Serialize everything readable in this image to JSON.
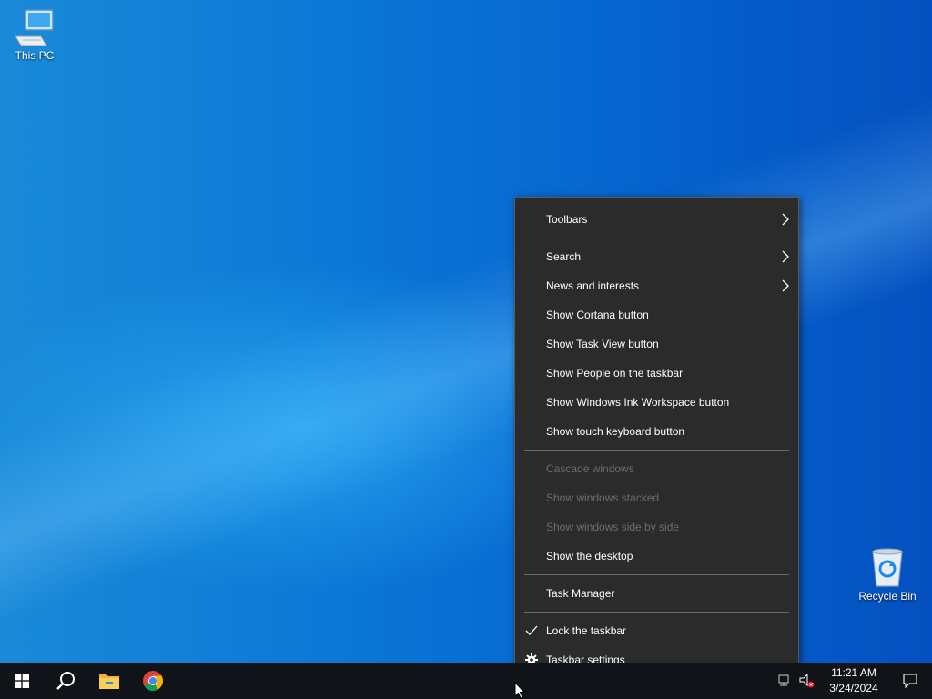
{
  "desktop": {
    "icons": [
      {
        "label": "This PC",
        "icon": "computer-icon"
      },
      {
        "label": "Recycle Bin",
        "icon": "recycle-bin-icon"
      }
    ]
  },
  "context_menu": {
    "items": {
      "toolbars": "Toolbars",
      "search": "Search",
      "news": "News and interests",
      "cortana": "Show Cortana button",
      "task_view": "Show Task View button",
      "people": "Show People on the taskbar",
      "ink": "Show Windows Ink Workspace button",
      "touch_keyboard": "Show touch keyboard button",
      "cascade": "Cascade windows",
      "stacked": "Show windows stacked",
      "side_by_side": "Show windows side by side",
      "show_desktop": "Show the desktop",
      "task_manager": "Task Manager",
      "lock_taskbar": "Lock the taskbar",
      "taskbar_settings": "Taskbar settings"
    },
    "lock_taskbar_checked": true
  },
  "taskbar": {
    "pinned": [
      {
        "icon": "windows-start-icon"
      },
      {
        "icon": "search-icon"
      },
      {
        "icon": "file-explorer-icon"
      },
      {
        "icon": "chrome-icon"
      }
    ],
    "clock": {
      "time": "11:21 AM",
      "date": "3/24/2024"
    },
    "tray_icons": [
      "network-icon",
      "volume-muted-icon",
      "notification-icon"
    ]
  },
  "colors": {
    "menu_bg": "#2b2b2b",
    "taskbar_bg": "#101418",
    "desktop_blue": "#0b78d6"
  }
}
